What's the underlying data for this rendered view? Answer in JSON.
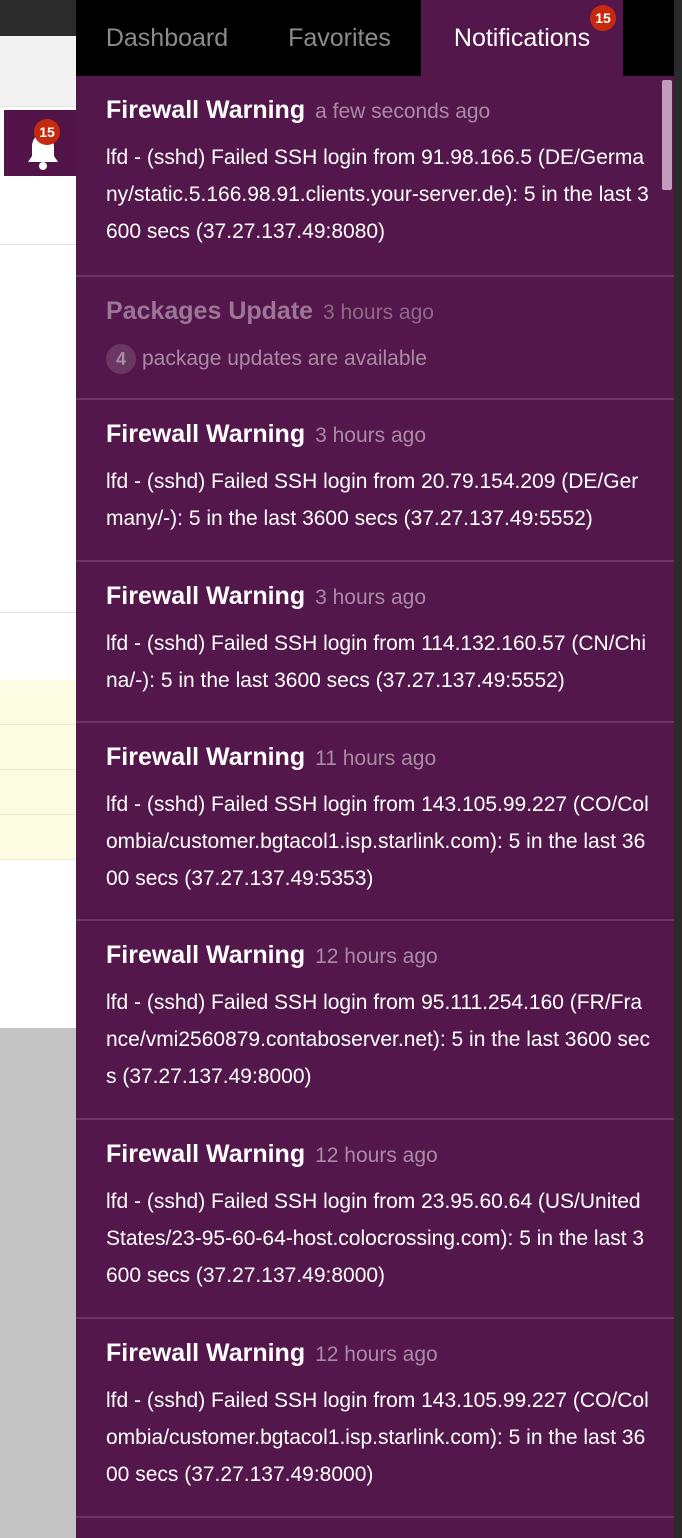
{
  "tabs": [
    {
      "label": "Dashboard"
    },
    {
      "label": "Favorites"
    },
    {
      "label": "Notifications",
      "badge": "15"
    }
  ],
  "bell_badge": "15",
  "notifications": [
    {
      "title": "Firewall Warning",
      "time": "a few seconds ago",
      "body": "lfd - (sshd) Failed SSH login from 91.98.166.5 (DE/Germany/static.5.166.98.91.clients.your-server.de): 5 in the last 3600 secs (37.27.137.49:8080)"
    },
    {
      "title": "Packages Update",
      "time": "3 hours ago",
      "count": "4",
      "body": "package updates are available",
      "read": true
    },
    {
      "title": "Firewall Warning",
      "time": "3 hours ago",
      "body": "lfd - (sshd) Failed SSH login from 20.79.154.209 (DE/Germany/-): 5 in the last 3600 secs (37.27.137.49:5552)"
    },
    {
      "title": "Firewall Warning",
      "time": "3 hours ago",
      "body": "lfd - (sshd) Failed SSH login from 114.132.160.57 (CN/China/-): 5 in the last 3600 secs (37.27.137.49:5552)"
    },
    {
      "title": "Firewall Warning",
      "time": "11 hours ago",
      "body": "lfd - (sshd) Failed SSH login from 143.105.99.227 (CO/Colombia/customer.bgtacol1.isp.starlink.com): 5 in the last 3600 secs (37.27.137.49:5353)"
    },
    {
      "title": "Firewall Warning",
      "time": "12 hours ago",
      "body": "lfd - (sshd) Failed SSH login from 95.111.254.160 (FR/France/vmi2560879.contaboserver.net): 5 in the last 3600 secs (37.27.137.49:8000)"
    },
    {
      "title": "Firewall Warning",
      "time": "12 hours ago",
      "body": "lfd - (sshd) Failed SSH login from 23.95.60.64 (US/United States/23-95-60-64-host.colocrossing.com): 5 in the last 3600 secs (37.27.137.49:8000)"
    },
    {
      "title": "Firewall Warning",
      "time": "12 hours ago",
      "body": "lfd - (sshd) Failed SSH login from 143.105.99.227 (CO/Colombia/customer.bgtacol1.isp.starlink.com): 5 in the last 3600 secs (37.27.137.49:8000)"
    }
  ],
  "colors": {
    "panel": "#53174b",
    "tab_bar": "#000000",
    "badge": "#c52a0d",
    "divider": "#6c3364"
  }
}
